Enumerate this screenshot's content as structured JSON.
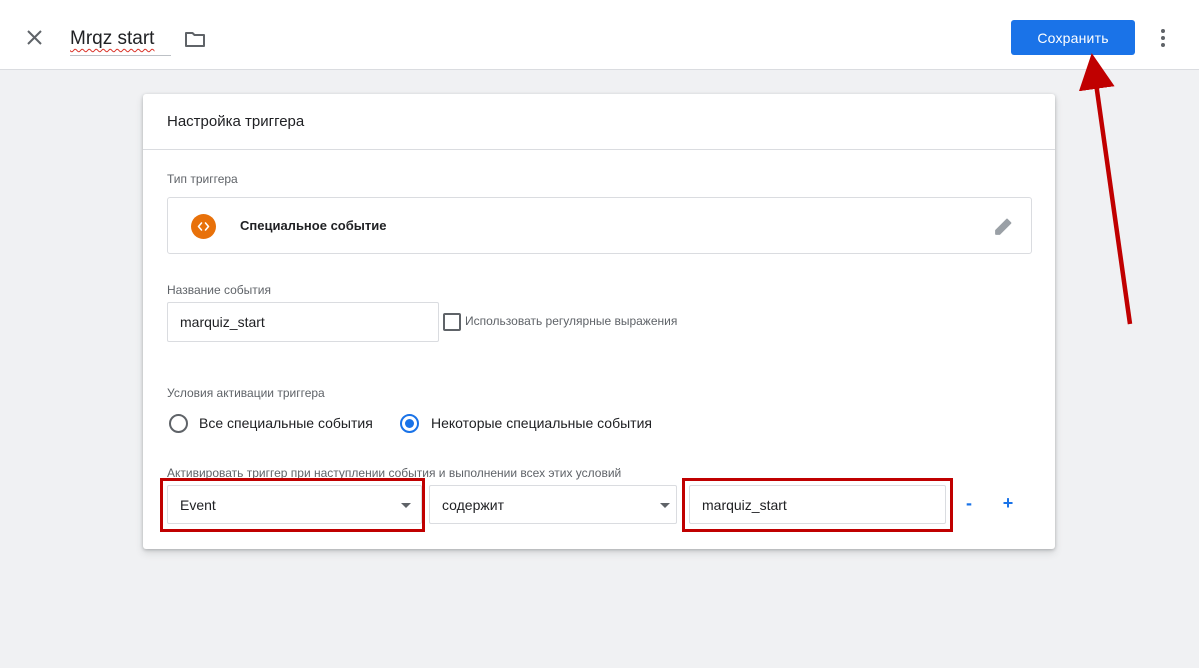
{
  "header": {
    "tag_name": "Mrqz start",
    "save_label": "Сохранить"
  },
  "trigger_config": {
    "title": "Настройка триггера",
    "type_label": "Тип триггера",
    "type_name": "Специальное событие",
    "event_name_label": "Название события",
    "event_name_value": "marquiz_start",
    "regex_label": "Использовать регулярные выражения",
    "regex_checked": false,
    "activation_label": "Условия активации триггера",
    "radio_all_label": "Все специальные события",
    "radio_some_label": "Некоторые специальные события",
    "selected_option": "some",
    "condition_label": "Активировать триггер при наступлении события и выполнении всех этих условий",
    "condition": {
      "variable": "Event",
      "operator": "содержит",
      "value": "marquiz_start"
    },
    "remove_label": "-",
    "add_label": "+"
  },
  "colors": {
    "accent": "#1a73e8",
    "annotation": "#c00000",
    "trigger_icon": "#e8710a"
  },
  "icons": {
    "close": "close-icon",
    "folder": "folder-icon",
    "more": "more-vert-icon",
    "trigger_type": "custom-event-icon",
    "edit": "pencil-icon"
  }
}
